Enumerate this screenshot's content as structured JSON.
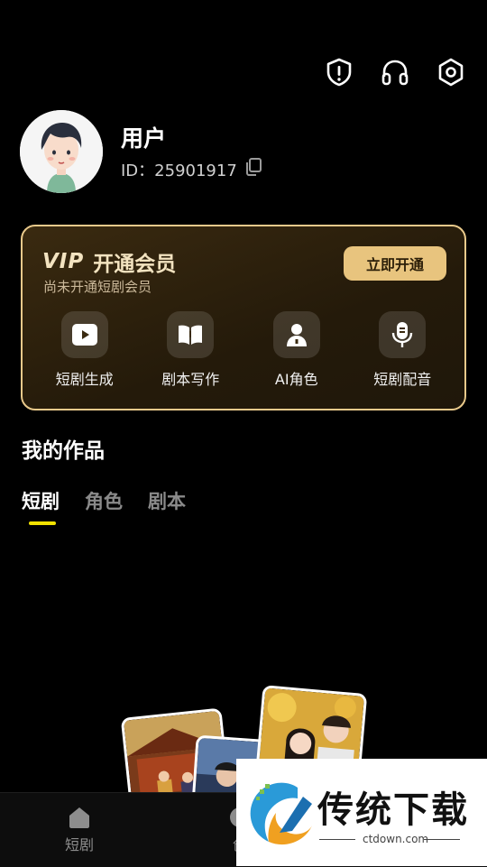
{
  "header": {
    "icons": [
      "shield-alert-icon",
      "headphones-icon",
      "settings-hex-icon"
    ]
  },
  "profile": {
    "name": "用户",
    "id_label": "ID：25901917"
  },
  "vip": {
    "logo_text": "VIP",
    "title": "开通会员",
    "subtitle": "尚未开通短剧会员",
    "button": "立即开通",
    "features": [
      {
        "label": "短剧生成",
        "icon": "play-icon"
      },
      {
        "label": "剧本写作",
        "icon": "book-icon"
      },
      {
        "label": "AI角色",
        "icon": "person-icon"
      },
      {
        "label": "短剧配音",
        "icon": "mic-icon"
      }
    ],
    "accent": "#e8c47e"
  },
  "works": {
    "title": "我的作品",
    "tabs": [
      {
        "label": "短剧",
        "active": true
      },
      {
        "label": "角色",
        "active": false
      },
      {
        "label": "剧本",
        "active": false
      }
    ],
    "underline_color": "#f2e200"
  },
  "nav": {
    "items": [
      {
        "label": "短剧",
        "icon": "home-icon"
      },
      {
        "label": "创",
        "icon": "create-icon"
      }
    ]
  },
  "watermark": {
    "text": "传统下载",
    "domain": "ctdown.com"
  }
}
